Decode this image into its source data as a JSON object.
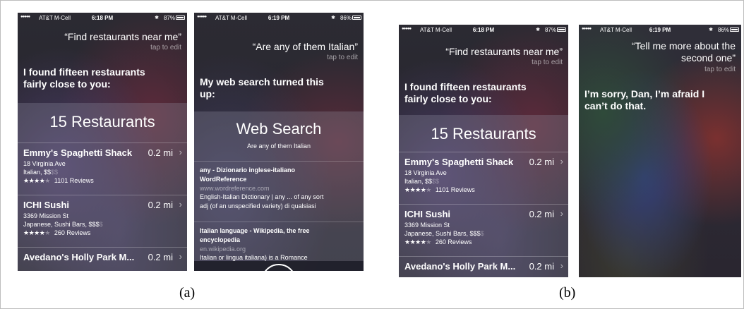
{
  "status_bars": {
    "s1": {
      "carrier": "AT&T M-Cell",
      "time": "6:18 PM",
      "battery": "87%",
      "signal": "●●●●●",
      "wifi_icon": "wifi-icon",
      "bluetooth_icon": "bluetooth-icon"
    },
    "s2": {
      "carrier": "AT&T M-Cell",
      "time": "6:19 PM",
      "battery": "86%",
      "signal": "●●●●●"
    },
    "s3": {
      "carrier": "AT&T M-Cell",
      "time": "6:18 PM",
      "battery": "87%",
      "signal": "●●●●●"
    },
    "s4": {
      "carrier": "AT&T M-Cell",
      "time": "6:19 PM",
      "battery": "86%",
      "signal": "●●●●●"
    }
  },
  "tap_to_edit": "tap to edit",
  "screen1": {
    "query": "“Find restaurants near me”",
    "response_1": "I found fifteen restaurants",
    "response_2": "fairly close to you:",
    "card_title": "15 Restaurants"
  },
  "screen2": {
    "query": "“Are any of them Italian”",
    "response_1": "My web search turned this",
    "response_2": "up:",
    "card_title": "Web Search",
    "card_subtitle": "Are any of them Italian",
    "results": [
      {
        "title_1": "any - Dizionario inglese-italiano",
        "title_2": "WordReference",
        "url": "www.wordreference.com",
        "snippet_1": "English-Italian Dictionary | any ... of any sort",
        "snippet_2": "adj (of an unspecified variety) di qualsiasi"
      },
      {
        "title_1": "Italian language - Wikipedia, the free",
        "title_2": "encyclopedia",
        "url": "en.wikipedia.org",
        "snippet_1": "Italian or lingua italiana) is a Romance",
        "snippet_2": ""
      }
    ]
  },
  "screen3": {
    "query": "“Find restaurants near me”",
    "response_1": "I found fifteen restaurants",
    "response_2": "fairly close to you:",
    "card_title": "15 Restaurants"
  },
  "screen4": {
    "query_1": "“Tell me more about the",
    "query_2": "second one”",
    "response_1": "I’m sorry, Dan, I’m afraid I",
    "response_2": "can’t do that."
  },
  "restaurants": [
    {
      "name": "Emmy's Spaghetti Shack",
      "distance": "0.2 mi",
      "address": "18 Virginia Ave",
      "category": "Italian, $$",
      "category_dim": "$$",
      "stars_on": "★★★★",
      "stars_off": "★",
      "reviews": "1101 Reviews"
    },
    {
      "name": "ICHI Sushi",
      "distance": "0.2 mi",
      "address": "3369 Mission St",
      "category": "Japanese, Sushi Bars, $$$",
      "category_dim": "$",
      "stars_on": "★★★★",
      "stars_off": "★",
      "reviews": "260 Reviews"
    },
    {
      "name": "Avedano's Holly Park M...",
      "distance": "0.2 mi"
    }
  ],
  "chevron": "›",
  "captions": {
    "a": "(a)",
    "b": "(b)"
  }
}
